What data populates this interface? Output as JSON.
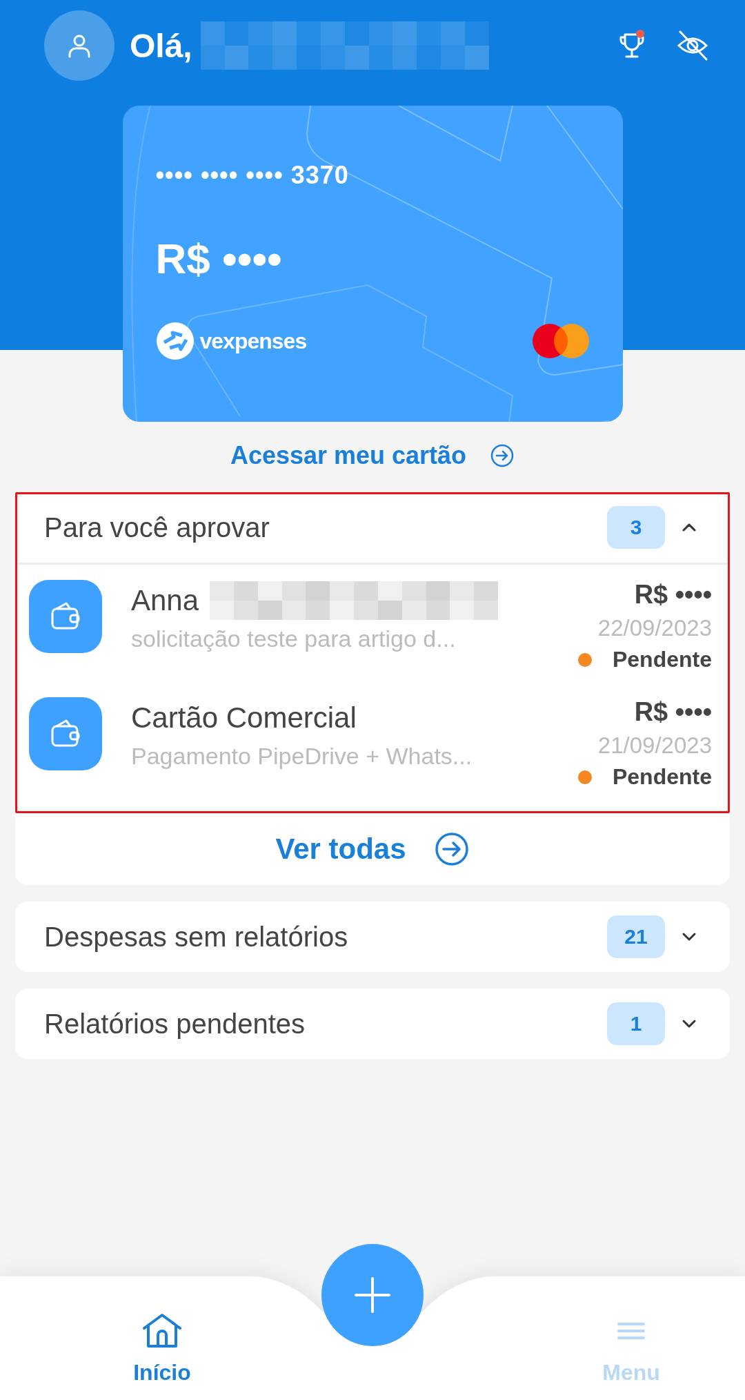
{
  "header": {
    "greeting": "Olá,",
    "name_redacted": true,
    "trophy_notification": true
  },
  "card": {
    "number": "•••• •••• •••• 3370",
    "balance": "R$ ••••",
    "brand": "vexpenses"
  },
  "card_link": "Acessar meu cartão",
  "sections": [
    {
      "title": "Para você aprovar",
      "count": "3",
      "expanded": true,
      "highlighted": true,
      "footer_link": "Ver todas",
      "items": [
        {
          "name": "Anna",
          "redacted": true,
          "description": "solicitação teste para artigo d...",
          "amount": "R$ ••••",
          "date": "22/09/2023",
          "status": "Pendente",
          "color": "#f5891f"
        },
        {
          "name": "Cartão Comercial",
          "redacted": false,
          "description": "Pagamento PipeDrive +  Whats...",
          "amount": "R$ ••••",
          "date": "21/09/2023",
          "status": "Pendente",
          "color": "#f5891f"
        }
      ]
    },
    {
      "title": "Despesas sem relatórios",
      "count": "21",
      "expanded": false,
      "highlighted": false
    },
    {
      "title": "Relatórios pendentes",
      "count": "1",
      "expanded": false,
      "highlighted": false
    }
  ],
  "nav": [
    {
      "label": "Início",
      "kind": "home",
      "selected": true
    },
    {
      "label": "Menu",
      "kind": "menu",
      "selected": false
    }
  ]
}
